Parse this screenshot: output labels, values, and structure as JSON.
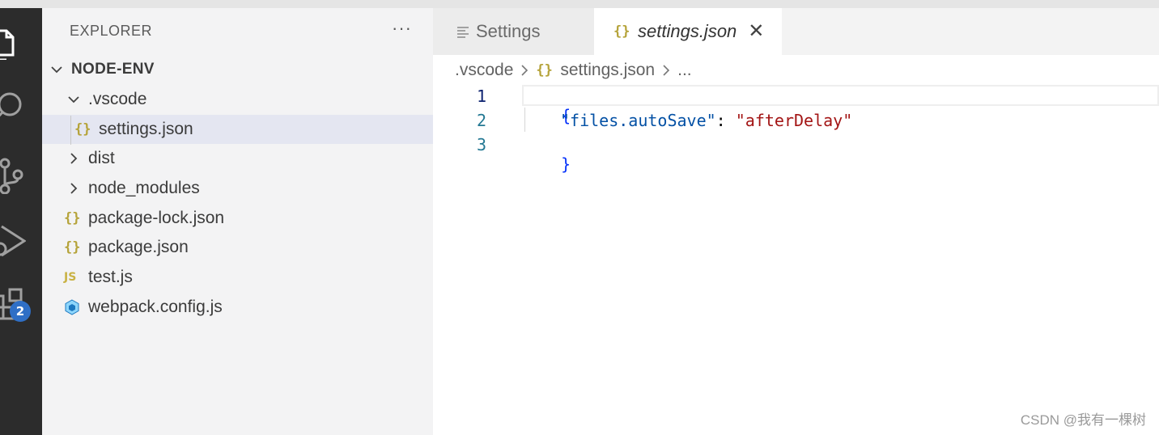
{
  "activity_bar": {
    "extensions_badge": "2"
  },
  "sidebar": {
    "title": "EXPLORER",
    "more_actions": "···",
    "tree": [
      {
        "label": "NODE-ENV",
        "kind": "root-folder",
        "expanded": true
      },
      {
        "label": ".vscode",
        "kind": "folder",
        "expanded": true
      },
      {
        "label": "settings.json",
        "kind": "json-file",
        "icon": "{}",
        "selected": true
      },
      {
        "label": "dist",
        "kind": "folder",
        "expanded": false
      },
      {
        "label": "node_modules",
        "kind": "folder",
        "expanded": false
      },
      {
        "label": "package-lock.json",
        "kind": "json-file",
        "icon": "{}"
      },
      {
        "label": "package.json",
        "kind": "json-file",
        "icon": "{}"
      },
      {
        "label": "test.js",
        "kind": "js-file",
        "icon": "JS"
      },
      {
        "label": "webpack.config.js",
        "kind": "webpack-file"
      }
    ]
  },
  "tabs": [
    {
      "label": "Settings",
      "icon": "settings-list-icon",
      "active": false
    },
    {
      "label": "settings.json",
      "icon": "{}",
      "active": true,
      "close": "✕"
    }
  ],
  "breadcrumb": {
    "folder": ".vscode",
    "file_icon": "{}",
    "file": "settings.json",
    "tail": "..."
  },
  "editor": {
    "line_numbers": [
      "1",
      "2",
      "3"
    ],
    "lines": {
      "open_brace": "{",
      "key": "\"files.autoSave\"",
      "colon": ": ",
      "value": "\"afterDelay\"",
      "close_brace": "}"
    }
  },
  "watermark": "CSDN @我有一棵树",
  "colors": {
    "activity_bar": "#2c2c2c",
    "sidebar": "#f3f3f4",
    "selected_row": "#e4e6f1",
    "badge": "#2f6fc6",
    "json_key": "#0451a5",
    "json_string": "#a31515",
    "brace": "#0431fa"
  }
}
